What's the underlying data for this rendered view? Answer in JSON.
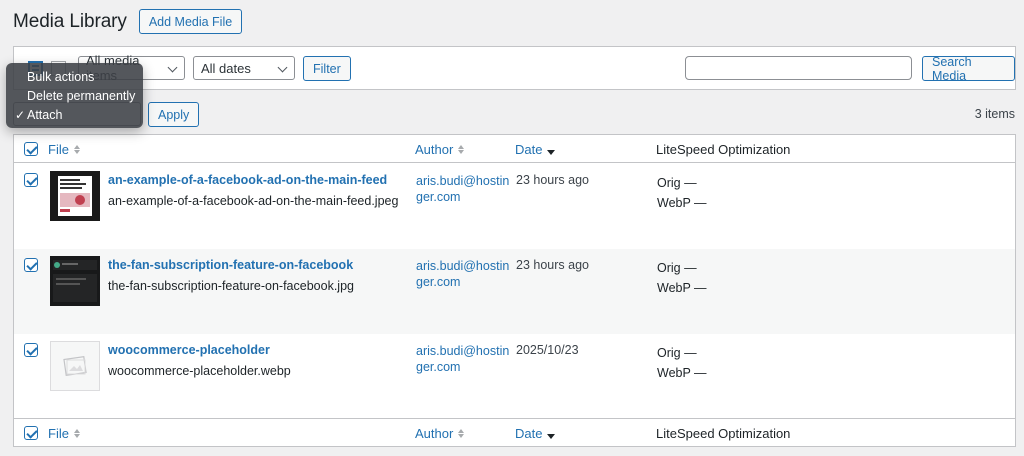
{
  "header": {
    "title": "Media Library",
    "add_button": "Add Media File"
  },
  "filters": {
    "type_select": "All media items",
    "dates_select": "All dates",
    "filter_button": "Filter",
    "search_value": "",
    "search_button": "Search Media"
  },
  "bulk_menu": {
    "items": [
      {
        "label": "Bulk actions",
        "checked": false
      },
      {
        "label": "Delete permanently",
        "checked": false
      },
      {
        "label": "Attach",
        "checked": true
      }
    ],
    "check_glyph": "✓",
    "apply_button": "Apply"
  },
  "items_count": "3 items",
  "columns": {
    "file": "File",
    "author": "Author",
    "date": "Date",
    "litespeed": "LiteSpeed Optimization"
  },
  "rows": [
    {
      "title": "an-example-of-a-facebook-ad-on-the-main-feed",
      "filename": "an-example-of-a-facebook-ad-on-the-main-feed.jpeg",
      "author": "aris.budi@hostinger.com",
      "date": "23 hours ago",
      "orig": "Orig —",
      "webp": "WebP —"
    },
    {
      "title": "the-fan-subscription-feature-on-facebook",
      "filename": "the-fan-subscription-feature-on-facebook.jpg",
      "author": "aris.budi@hostinger.com",
      "date": "23 hours ago",
      "orig": "Orig —",
      "webp": "WebP —"
    },
    {
      "title": "woocommerce-placeholder",
      "filename": "woocommerce-placeholder.webp",
      "author": "aris.budi@hostinger.com",
      "date": "2025/10/23",
      "orig": "Orig —",
      "webp": "WebP —"
    }
  ],
  "colors": {
    "accent": "#2271b1",
    "border": "#c3c4c7",
    "bg": "#f0f0f1"
  }
}
